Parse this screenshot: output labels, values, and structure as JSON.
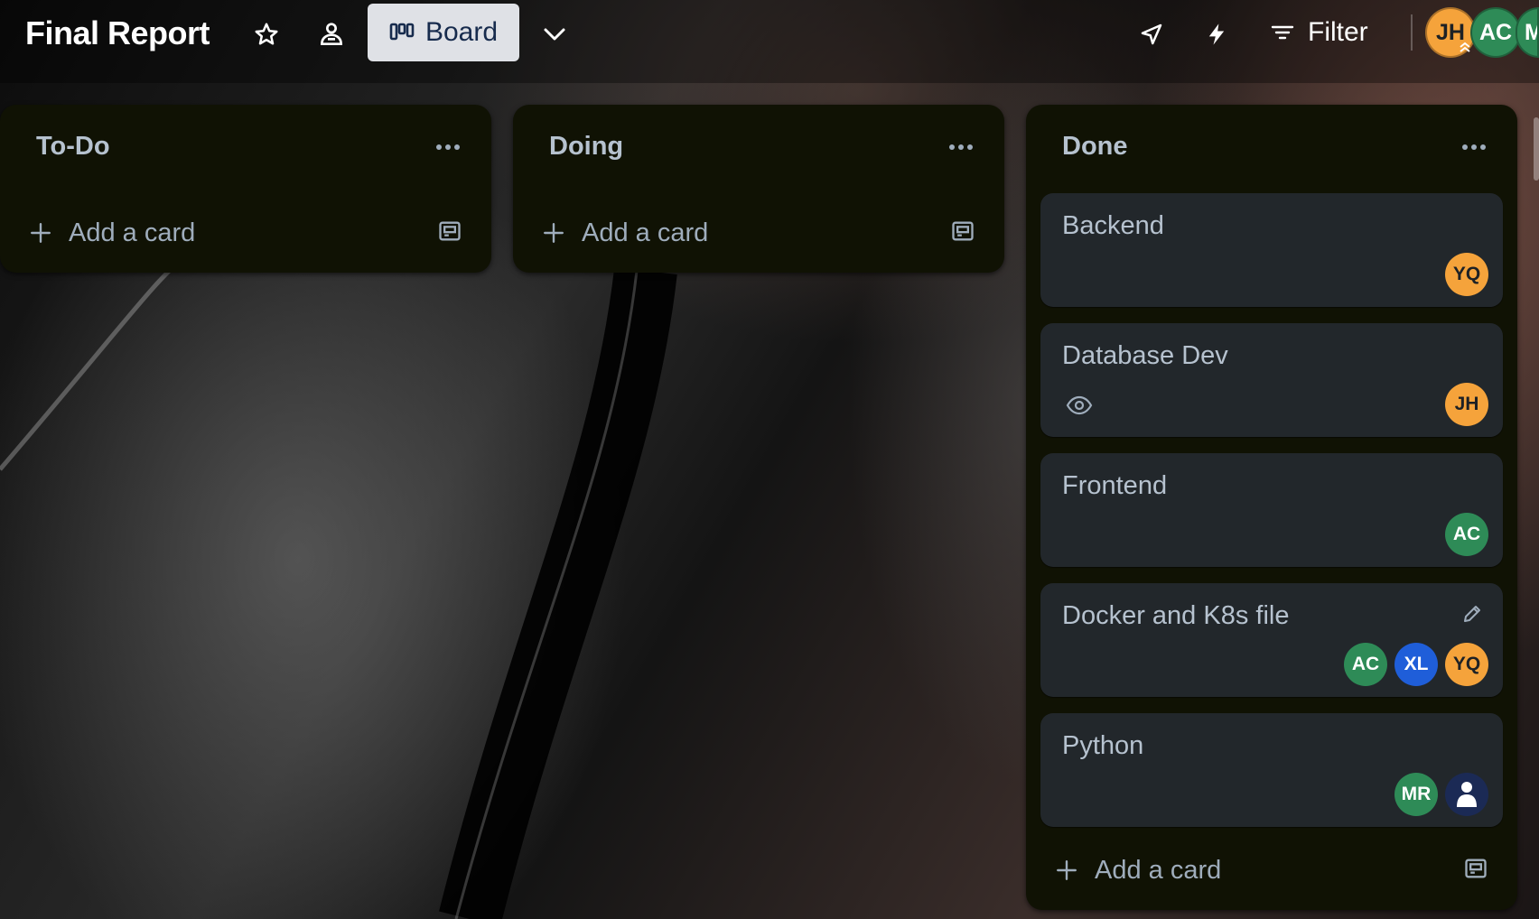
{
  "header": {
    "board_title": "Final Report",
    "view_label": "Board",
    "filter_label": "Filter",
    "members": [
      {
        "initials": "JH",
        "color": "#f5a33b"
      },
      {
        "initials": "AC",
        "color": "#2e8b57"
      },
      {
        "initials": "M",
        "color": "#2e8b57"
      }
    ],
    "icons": [
      "star-icon",
      "visibility-icon",
      "board-icon",
      "chevron-down-icon",
      "power-ups-icon",
      "automation-icon",
      "filter-icon"
    ]
  },
  "lists": [
    {
      "title": "To-Do",
      "add_card_label": "Add a card",
      "cards": []
    },
    {
      "title": "Doing",
      "add_card_label": "Add a card",
      "cards": []
    },
    {
      "title": "Done",
      "add_card_label": "Add a card",
      "cards": [
        {
          "title": "Backend",
          "members": [
            {
              "initials": "YQ",
              "color": "#f5a33b"
            }
          ]
        },
        {
          "title": "Database Dev",
          "watching": true,
          "members": [
            {
              "initials": "JH",
              "color": "#f5a33b"
            }
          ]
        },
        {
          "title": "Frontend",
          "members": [
            {
              "initials": "AC",
              "color": "#2e8b57"
            }
          ]
        },
        {
          "title": "Docker and K8s file",
          "members": [
            {
              "initials": "AC",
              "color": "#2e8b57"
            },
            {
              "initials": "XL",
              "color": "#1f5ed9"
            },
            {
              "initials": "YQ",
              "color": "#f5a33b"
            }
          ]
        },
        {
          "title": "Python",
          "members": [
            {
              "initials": "MR",
              "color": "#2e8b57"
            },
            {
              "initials": "",
              "color": "#1b2a55",
              "icon": "person-icon"
            }
          ]
        }
      ]
    }
  ]
}
